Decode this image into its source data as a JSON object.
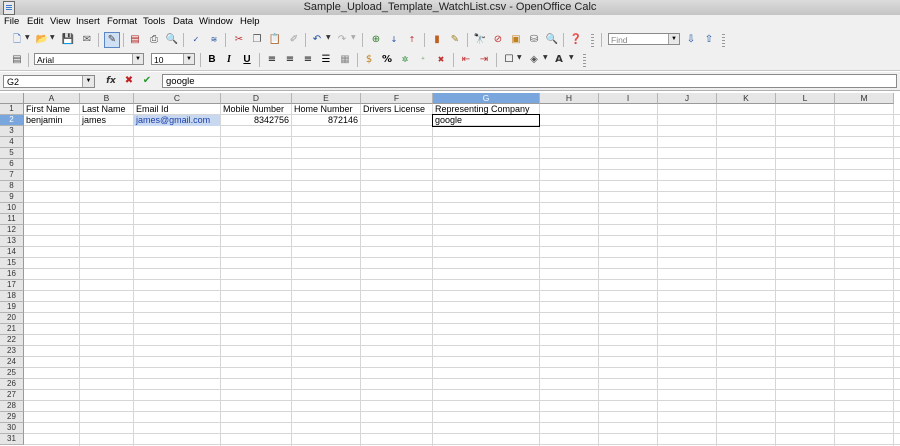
{
  "window": {
    "title": "Sample_Upload_Template_WatchList.csv - OpenOffice Calc"
  },
  "menu": [
    {
      "key": "file",
      "label": "File"
    },
    {
      "key": "edit",
      "label": "Edit"
    },
    {
      "key": "view",
      "label": "View"
    },
    {
      "key": "insert",
      "label": "Insert"
    },
    {
      "key": "format",
      "label": "Format"
    },
    {
      "key": "tools",
      "label": "Tools"
    },
    {
      "key": "data",
      "label": "Data"
    },
    {
      "key": "window",
      "label": "Window"
    },
    {
      "key": "help",
      "label": "Help"
    }
  ],
  "toolbar": {
    "find_placeholder": "Find",
    "font_name": "Arial",
    "font_size": "10",
    "bold": "B",
    "italic": "I",
    "underline": "U",
    "percent": "%"
  },
  "formula_bar": {
    "cell_ref": "G2",
    "function_wizard": "fx",
    "content": "google"
  },
  "columns": [
    "A",
    "B",
    "C",
    "D",
    "E",
    "F",
    "G",
    "H",
    "I",
    "J",
    "K",
    "L",
    "M"
  ],
  "selected_column": "G",
  "rows": [
    "1",
    "2",
    "3",
    "4",
    "5",
    "6",
    "7",
    "8",
    "9",
    "10",
    "11",
    "12",
    "13",
    "14",
    "15",
    "16",
    "17",
    "18",
    "19",
    "20",
    "21",
    "22",
    "23",
    "24",
    "25",
    "26",
    "27",
    "28",
    "29",
    "30",
    "31"
  ],
  "selected_row": "2",
  "cells": {
    "A1": "First Name",
    "B1": "Last Name",
    "C1": "Email Id",
    "D1": "Mobile Number",
    "E1": "Home Number",
    "F1": "Drivers License",
    "G1": "Representing Company",
    "A2": "benjamin",
    "B2": "james",
    "C2": "james@gmail.com",
    "D2": "8342756",
    "E2": "872146",
    "G2": "google"
  }
}
